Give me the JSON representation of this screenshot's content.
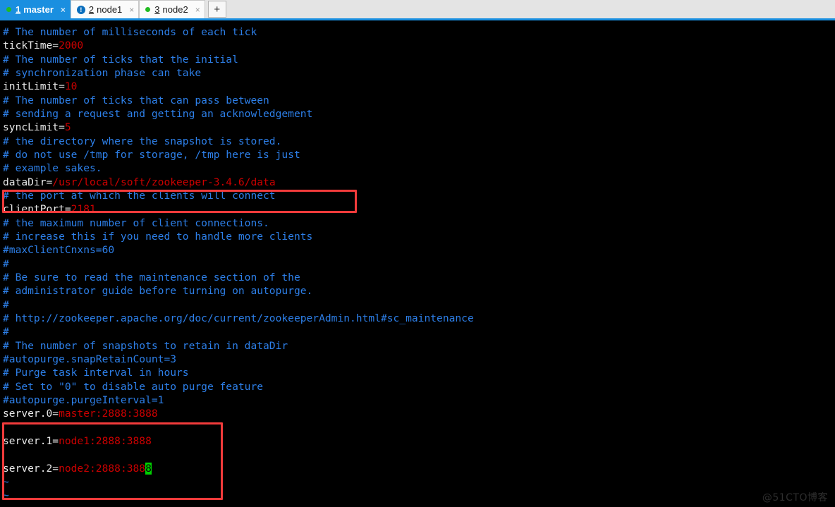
{
  "tabs": [
    {
      "num": "1",
      "label": "master",
      "status": "green-dot",
      "active": true,
      "close": "×"
    },
    {
      "num": "2",
      "label": "node1",
      "status": "alert-icon",
      "alert_glyph": "!",
      "active": false,
      "close": "×"
    },
    {
      "num": "3",
      "label": "node2",
      "status": "green-dot",
      "active": false,
      "close": "×"
    }
  ],
  "tabbar": {
    "add_tab_label": "+"
  },
  "colors": {
    "tab_active_bg": "#1a8fe0",
    "tab_bar_bg": "#e4e4e4",
    "terminal_bg": "#000000",
    "comment": "#2d7fe8",
    "key": "#e8e8e8",
    "value": "#cc0000",
    "cursor": "#00d000",
    "annotation_box": "#f23b3b"
  },
  "terminal": {
    "lines": [
      {
        "segments": [
          {
            "text": "# The number of milliseconds of each tick",
            "cls": "c-comment"
          }
        ]
      },
      {
        "segments": [
          {
            "text": "tickTime=",
            "cls": "c-key"
          },
          {
            "text": "2000",
            "cls": "c-val"
          }
        ]
      },
      {
        "segments": [
          {
            "text": "# The number of ticks that the initial",
            "cls": "c-comment"
          }
        ]
      },
      {
        "segments": [
          {
            "text": "# synchronization phase can take",
            "cls": "c-comment"
          }
        ]
      },
      {
        "segments": [
          {
            "text": "initLimit=",
            "cls": "c-key"
          },
          {
            "text": "10",
            "cls": "c-val"
          }
        ]
      },
      {
        "segments": [
          {
            "text": "# The number of ticks that can pass between",
            "cls": "c-comment"
          }
        ]
      },
      {
        "segments": [
          {
            "text": "# sending a request and getting an acknowledgement",
            "cls": "c-comment"
          }
        ]
      },
      {
        "segments": [
          {
            "text": "syncLimit=",
            "cls": "c-key"
          },
          {
            "text": "5",
            "cls": "c-val"
          }
        ]
      },
      {
        "segments": [
          {
            "text": "# the directory where the snapshot is stored.",
            "cls": "c-comment"
          }
        ]
      },
      {
        "segments": [
          {
            "text": "# do not use /tmp for storage, /tmp here is just",
            "cls": "c-comment"
          }
        ]
      },
      {
        "segments": [
          {
            "text": "# example sakes.",
            "cls": "c-comment"
          }
        ]
      },
      {
        "segments": [
          {
            "text": "dataDir=",
            "cls": "c-key"
          },
          {
            "text": "/usr/local/soft/zookeeper-3.4.6/data",
            "cls": "c-val"
          }
        ]
      },
      {
        "segments": [
          {
            "text": "# the port at which the clients will connect",
            "cls": "c-comment"
          }
        ]
      },
      {
        "segments": [
          {
            "text": "clientPort=",
            "cls": "c-key"
          },
          {
            "text": "2181",
            "cls": "c-val"
          }
        ]
      },
      {
        "segments": [
          {
            "text": "# the maximum number of client connections.",
            "cls": "c-comment"
          }
        ]
      },
      {
        "segments": [
          {
            "text": "# increase this if you need to handle more clients",
            "cls": "c-comment"
          }
        ]
      },
      {
        "segments": [
          {
            "text": "#maxClientCnxns=60",
            "cls": "c-comment"
          }
        ]
      },
      {
        "segments": [
          {
            "text": "#",
            "cls": "c-comment"
          }
        ]
      },
      {
        "segments": [
          {
            "text": "# Be sure to read the maintenance section of the",
            "cls": "c-comment"
          }
        ]
      },
      {
        "segments": [
          {
            "text": "# administrator guide before turning on autopurge.",
            "cls": "c-comment"
          }
        ]
      },
      {
        "segments": [
          {
            "text": "#",
            "cls": "c-comment"
          }
        ]
      },
      {
        "segments": [
          {
            "text": "# http://zookeeper.apache.org/doc/current/zookeeperAdmin.html#sc_maintenance",
            "cls": "c-comment"
          }
        ]
      },
      {
        "segments": [
          {
            "text": "#",
            "cls": "c-comment"
          }
        ]
      },
      {
        "segments": [
          {
            "text": "# The number of snapshots to retain in dataDir",
            "cls": "c-comment"
          }
        ]
      },
      {
        "segments": [
          {
            "text": "#autopurge.snapRetainCount=3",
            "cls": "c-comment"
          }
        ]
      },
      {
        "segments": [
          {
            "text": "# Purge task interval in hours",
            "cls": "c-comment"
          }
        ]
      },
      {
        "segments": [
          {
            "text": "# Set to \"0\" to disable auto purge feature",
            "cls": "c-comment"
          }
        ]
      },
      {
        "segments": [
          {
            "text": "#autopurge.purgeInterval=1",
            "cls": "c-comment"
          }
        ]
      },
      {
        "segments": [
          {
            "text": "server.0=",
            "cls": "c-key"
          },
          {
            "text": "master:2888:3888",
            "cls": "c-val"
          }
        ]
      },
      {
        "segments": [
          {
            "text": "",
            "cls": "c-key"
          }
        ]
      },
      {
        "segments": [
          {
            "text": "server.1=",
            "cls": "c-key"
          },
          {
            "text": "node1:2888:3888",
            "cls": "c-val"
          }
        ]
      },
      {
        "segments": [
          {
            "text": "",
            "cls": "c-key"
          }
        ]
      },
      {
        "segments": [
          {
            "text": "server.2=",
            "cls": "c-key"
          },
          {
            "text": "node2:2888:388",
            "cls": "c-val"
          },
          {
            "text": "8",
            "cls": "cursor"
          }
        ]
      },
      {
        "segments": [
          {
            "text": "~",
            "cls": "c-tilde"
          }
        ]
      },
      {
        "segments": [
          {
            "text": "~",
            "cls": "c-tilde"
          }
        ]
      }
    ]
  },
  "annotations": [
    {
      "name": "datadir-highlight-box",
      "target": "dataDir line"
    },
    {
      "name": "servers-highlight-box",
      "target": "server.0 / server.1 / server.2 lines"
    }
  ],
  "watermark": {
    "text": "@51CTO博客"
  }
}
